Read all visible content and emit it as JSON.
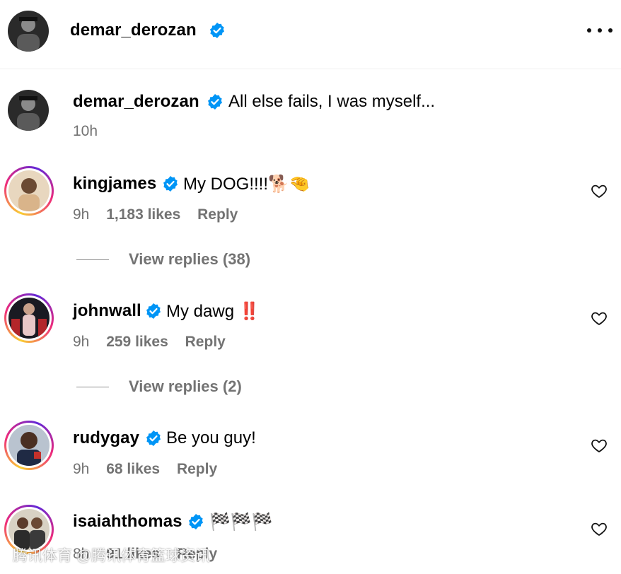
{
  "post": {
    "author": "demar_derozan",
    "caption": "All else fails, I was myself...",
    "time": "10h"
  },
  "comments": [
    {
      "username": "kingjames",
      "text": "My DOG!!!!",
      "emoji": "🐕🤏",
      "time": "9h",
      "likes": "1,183 likes",
      "reply_label": "Reply",
      "view_replies": "View replies (38)"
    },
    {
      "username": "johnwall",
      "text": "My dawg",
      "emoji": "‼️",
      "time": "9h",
      "likes": "259 likes",
      "reply_label": "Reply",
      "view_replies": "View replies (2)"
    },
    {
      "username": "rudygay",
      "text": "Be you guy!",
      "time": "9h",
      "likes": "68 likes",
      "reply_label": "Reply"
    },
    {
      "username": "isaiahthomas",
      "text": "🏁🏁🏁",
      "time": "8h",
      "likes": "91 likes",
      "reply_label": "Reply"
    }
  ],
  "watermark": "腾讯体育 @腾讯体育篮球资讯",
  "icons": {
    "verified": "verified-badge-icon",
    "heart": "heart-outline-icon",
    "more": "more-options-icon"
  },
  "colors": {
    "verified": "#0095f6",
    "muted": "#737373"
  }
}
